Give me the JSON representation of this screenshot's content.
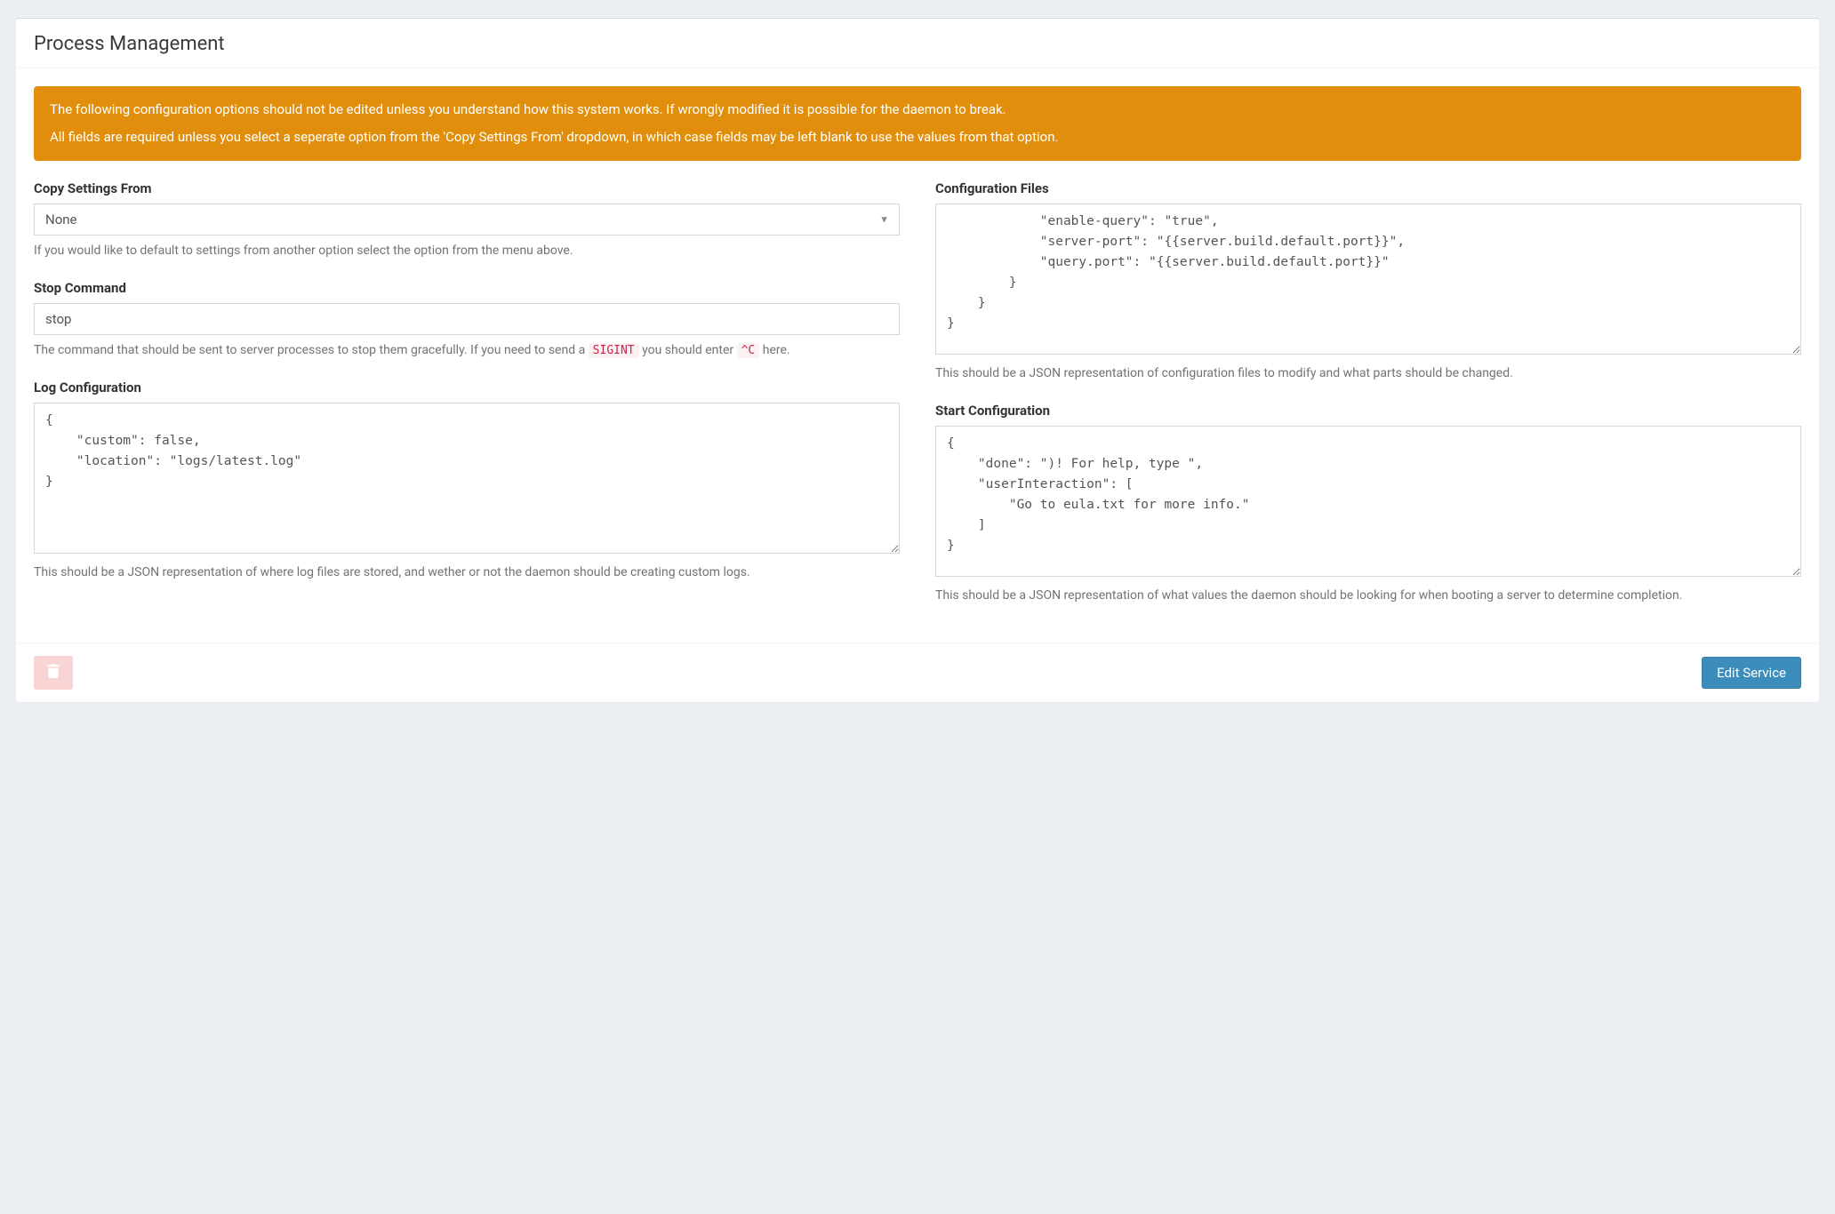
{
  "panel": {
    "title": "Process Management"
  },
  "alert": {
    "line1": "The following configuration options should not be edited unless you understand how this system works. If wrongly modified it is possible for the daemon to break.",
    "line2": "All fields are required unless you select a seperate option from the 'Copy Settings From' dropdown, in which case fields may be left blank to use the values from that option."
  },
  "left": {
    "copy": {
      "label": "Copy Settings From",
      "value": "None",
      "help": "If you would like to default to settings from another option select the option from the menu above."
    },
    "stop": {
      "label": "Stop Command",
      "value": "stop",
      "help_pre": "The command that should be sent to server processes to stop them gracefully. If you need to send a ",
      "code1": "SIGINT",
      "help_mid": " you should enter ",
      "code2": "^C",
      "help_post": " here."
    },
    "log": {
      "label": "Log Configuration",
      "value": "{\n    \"custom\": false,\n    \"location\": \"logs/latest.log\"\n}",
      "help": "This should be a JSON representation of where log files are stored, and wether or not the daemon should be creating custom logs."
    }
  },
  "right": {
    "config": {
      "label": "Configuration Files",
      "value": "            \"enable-query\": \"true\",\n            \"server-port\": \"{{server.build.default.port}}\",\n            \"query.port\": \"{{server.build.default.port}}\"\n        }\n    }\n}",
      "help": "This should be a JSON representation of configuration files to modify and what parts should be changed."
    },
    "start": {
      "label": "Start Configuration",
      "value": "{\n    \"done\": \")! For help, type \",\n    \"userInteraction\": [\n        \"Go to eula.txt for more info.\"\n    ]\n}",
      "help": "This should be a JSON representation of what values the daemon should be looking for when booting a server to determine completion."
    }
  },
  "footer": {
    "edit": "Edit Service"
  }
}
